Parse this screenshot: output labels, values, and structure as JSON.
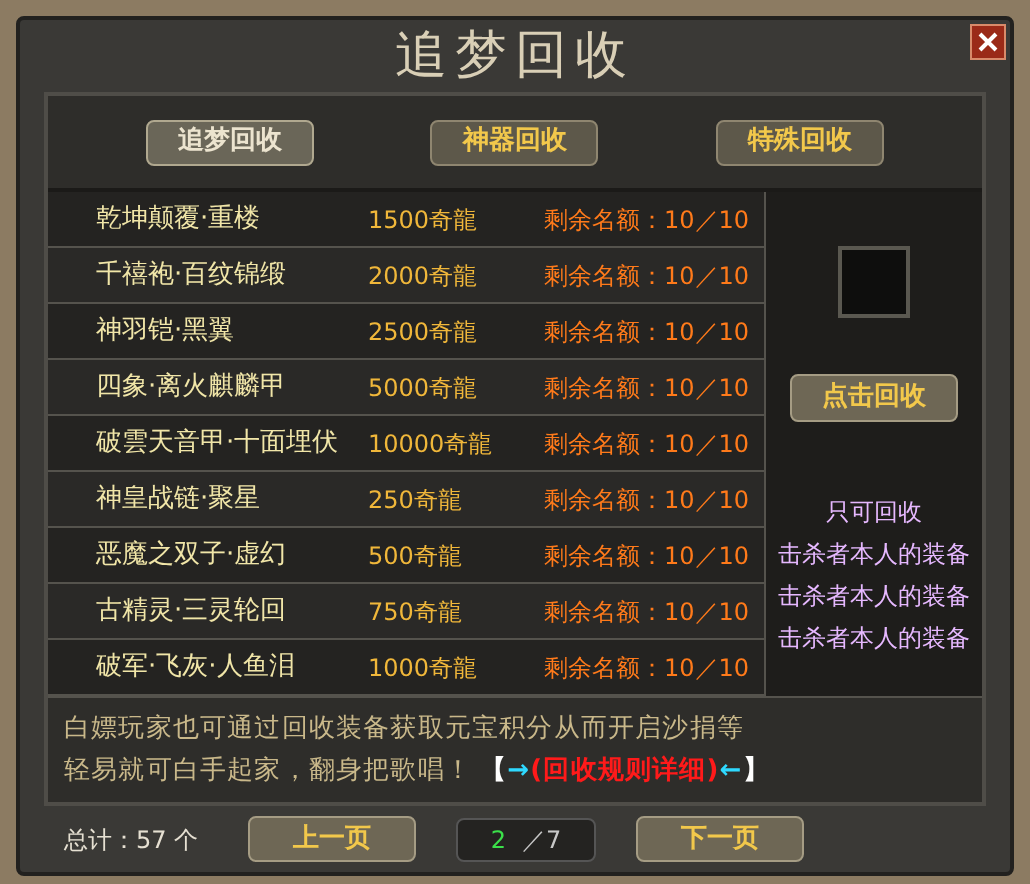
{
  "window": {
    "title": "追梦回收"
  },
  "tabs": [
    {
      "label": "追梦回收",
      "selected": true
    },
    {
      "label": "神器回收",
      "selected": false
    },
    {
      "label": "特殊回收",
      "selected": false
    }
  ],
  "items": [
    {
      "name": "乾坤颠覆·重楼",
      "price": "1500奇龍",
      "quota": "剩余名额：10／10"
    },
    {
      "name": "千禧袍·百纹锦缎",
      "price": "2000奇龍",
      "quota": "剩余名额：10／10"
    },
    {
      "name": "神羽铠·黑翼",
      "price": "2500奇龍",
      "quota": "剩余名额：10／10"
    },
    {
      "name": "四象·离火麒麟甲",
      "price": "5000奇龍",
      "quota": "剩余名额：10／10"
    },
    {
      "name": "破雲天音甲·十面埋伏",
      "price": "10000奇龍",
      "quota": "剩余名额：10／10"
    },
    {
      "name": "神皇战链·聚星",
      "price": "250奇龍",
      "quota": "剩余名额：10／10"
    },
    {
      "name": "恶魔之双子·虚幻",
      "price": "500奇龍",
      "quota": "剩余名额：10／10"
    },
    {
      "name": "古精灵·三灵轮回",
      "price": "750奇龍",
      "quota": "剩余名额：10／10"
    },
    {
      "name": "破军·飞灰·人鱼泪",
      "price": "1000奇龍",
      "quota": "剩余名额：10／10"
    }
  ],
  "side": {
    "button": "点击回收",
    "note_title": "只可回收",
    "notes": [
      "击杀者本人的装备",
      "击杀者本人的装备",
      "击杀者本人的装备"
    ]
  },
  "notice": {
    "lines": [
      "白嫖玩家也可通过回收装备获取元宝积分从而开启沙捐等",
      "轻易就可白手起家，翻身把歌唱！"
    ],
    "open": "【",
    "arrow_right": "→",
    "link": "(回收规则详细)",
    "arrow_left": "←",
    "close": "】"
  },
  "footer": {
    "total": "总计：57 个",
    "prev": "上一页",
    "page": "2",
    "pages": "／7",
    "next": "下一页"
  }
}
